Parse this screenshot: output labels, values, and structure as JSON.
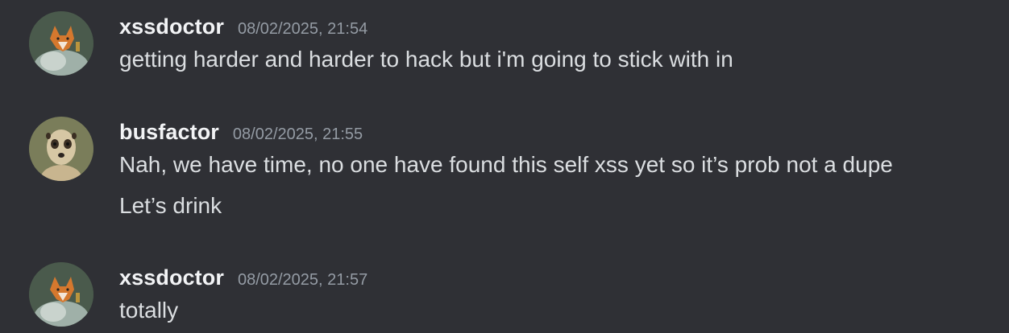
{
  "messages": [
    {
      "author": "xssdoctor",
      "timestamp": "08/02/2025, 21:54",
      "avatar_icon": "fox-avatar-icon",
      "lines": [
        "getting harder and harder to hack but i'm going to stick with in"
      ]
    },
    {
      "author": "busfactor",
      "timestamp": "08/02/2025, 21:55",
      "avatar_icon": "meerkat-avatar-icon",
      "lines": [
        "Nah, we have time, no one have found this self xss yet so it’s prob not a dupe",
        "Let’s drink"
      ]
    },
    {
      "author": "xssdoctor",
      "timestamp": "08/02/2025, 21:57",
      "avatar_icon": "fox-avatar-icon",
      "lines": [
        "totally"
      ]
    }
  ],
  "colors": {
    "background": "#2f3035",
    "username": "#f2f3f5",
    "timestamp": "#949ba4",
    "message_text": "#dbdee1"
  }
}
